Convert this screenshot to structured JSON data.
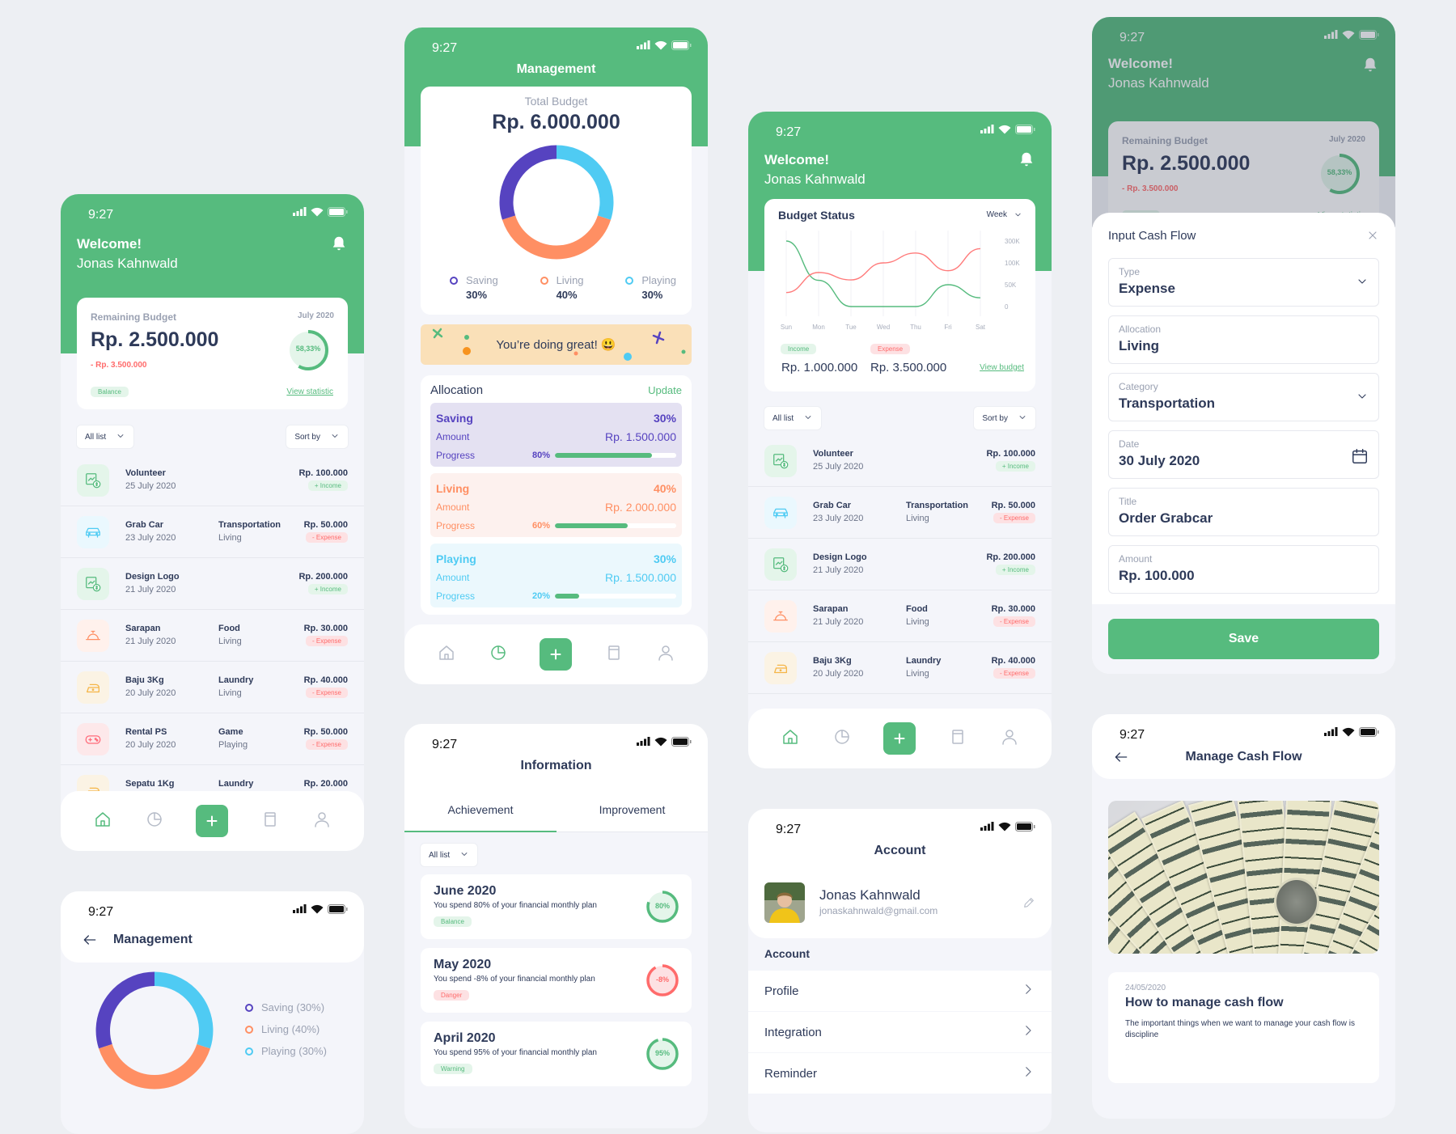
{
  "status_time": "9:27",
  "colors": {
    "green": "#56BB7E",
    "red": "#FF6B6B",
    "saving": "#5643C0",
    "living": "#FF8F63",
    "playing": "#4FCBF3",
    "text": "#2E3A59"
  },
  "nav_icons": [
    "home-icon",
    "pie-chart-icon",
    "plus-icon",
    "notebook-icon",
    "user-icon"
  ],
  "home": {
    "welcome": "Welcome!",
    "name": "Jonas Kahnwald",
    "card": {
      "label": "Remaining Budget",
      "month": "July 2020",
      "amount": "Rp. 2.500.000",
      "spent": "- Rp. 3.500.000",
      "badge": "Balance",
      "link": "View statistic",
      "percent_label": "58,33%",
      "percent": 58.33
    },
    "filters": {
      "all": "All list",
      "sort": "Sort by"
    },
    "transactions": [
      {
        "title": "Volunteer",
        "date": "25 July 2020",
        "category": "",
        "group": "",
        "amount": "Rp. 100.000",
        "type": "+ Income",
        "kind": "income",
        "icon": "income"
      },
      {
        "title": "Grab Car",
        "date": "23 July 2020",
        "category": "Transportation",
        "group": "Living",
        "amount": "Rp. 50.000",
        "type": "- Expense",
        "kind": "expense",
        "icon": "car"
      },
      {
        "title": "Design Logo",
        "date": "21 July 2020",
        "category": "",
        "group": "",
        "amount": "Rp. 200.000",
        "type": "+ Income",
        "kind": "income",
        "icon": "income"
      },
      {
        "title": "Sarapan",
        "date": "21 July 2020",
        "category": "Food",
        "group": "Living",
        "amount": "Rp. 30.000",
        "type": "- Expense",
        "kind": "expense",
        "icon": "food"
      },
      {
        "title": "Baju 3Kg",
        "date": "20 July 2020",
        "category": "Laundry",
        "group": "Living",
        "amount": "Rp. 40.000",
        "type": "- Expense",
        "kind": "expense",
        "icon": "laundry"
      },
      {
        "title": "Rental PS",
        "date": "20 July 2020",
        "category": "Game",
        "group": "Playing",
        "amount": "Rp. 50.000",
        "type": "- Expense",
        "kind": "expense",
        "icon": "game"
      },
      {
        "title": "Sepatu 1Kg",
        "date": "",
        "category": "Laundry",
        "group": "",
        "amount": "Rp. 20.000",
        "type": "",
        "kind": "expense",
        "icon": "laundry"
      }
    ]
  },
  "management": {
    "title": "Management",
    "total_label": "Total Budget",
    "total": "Rp. 6.000.000",
    "legend": [
      {
        "name": "Saving",
        "pct": "30%",
        "value": 30,
        "color": "#5643C0"
      },
      {
        "name": "Living",
        "pct": "40%",
        "value": 40,
        "color": "#FF8F63"
      },
      {
        "name": "Playing",
        "pct": "30%",
        "value": 30,
        "color": "#4FCBF3"
      }
    ],
    "banner": "You’re doing great! 😃",
    "allocation": {
      "title": "Allocation",
      "update": "Update",
      "items": [
        {
          "name": "Saving",
          "pct": "30%",
          "amount_label": "Amount",
          "amount": "Rp. 1.500.000",
          "progress_label": "Progress",
          "progress_text": "80%",
          "progress": 80,
          "color": "#5643C0",
          "bg": "#E4E1F2"
        },
        {
          "name": "Living",
          "pct": "40%",
          "amount_label": "Amount",
          "amount": "Rp. 2.000.000",
          "progress_label": "Progress",
          "progress_text": "60%",
          "progress": 60,
          "color": "#FF8F63",
          "bg": "#FDF1EE"
        },
        {
          "name": "Playing",
          "pct": "30%",
          "amount_label": "Amount",
          "amount": "Rp. 1.500.000",
          "progress_label": "Progress",
          "progress_text": "20%",
          "progress": 20,
          "color": "#4FCBF3",
          "bg": "#EBF8FD"
        }
      ]
    }
  },
  "dashboard": {
    "welcome": "Welcome!",
    "name": "Jonas Kahnwald",
    "budget_status": {
      "title": "Budget Status",
      "period": "Week",
      "income_label": "Income",
      "income": "Rp. 1.000.000",
      "expense_label": "Expense",
      "expense": "Rp. 3.500.000",
      "link": "View budget"
    }
  },
  "chart_data": {
    "type": "line",
    "title": "Budget Status",
    "categories": [
      "Sun",
      "Mon",
      "Tue",
      "Wed",
      "Thu",
      "Fri",
      "Sat"
    ],
    "y_ticks": [
      "300K",
      "100K",
      "50K",
      "0"
    ],
    "y_tick_values": [
      300000,
      100000,
      50000,
      0
    ],
    "grid": "vertical",
    "series": [
      {
        "name": "Income",
        "color": "#56BB7E",
        "values": [
          300000,
          60000,
          0,
          0,
          0,
          50000,
          20000
        ]
      },
      {
        "name": "Expense",
        "color": "#FF7B7B",
        "values": [
          32000,
          78000,
          61000,
          100000,
          190000,
          82000,
          230000
        ]
      }
    ]
  },
  "input_form": {
    "title": "Input Cash Flow",
    "fields": [
      {
        "label": "Type",
        "value": "Expense",
        "control": "chevron-down-icon"
      },
      {
        "label": "Allocation",
        "value": "Living",
        "control": ""
      },
      {
        "label": "Category",
        "value": "Transportation",
        "control": "chevron-down-icon"
      },
      {
        "label": "Date",
        "value": "30 July 2020",
        "control": "calendar-icon"
      },
      {
        "label": "Title",
        "value": "Order Grabcar",
        "control": ""
      },
      {
        "label": "Amount",
        "value": "Rp. 100.000",
        "control": ""
      }
    ],
    "save": "Save"
  },
  "management2": {
    "title": "Management",
    "legend": [
      "Saving (30%)",
      "Living (40%)",
      "Playing (30%)"
    ]
  },
  "information": {
    "title": "Information",
    "tabs": [
      "Achievement",
      "Improvement"
    ],
    "active_tab": 0,
    "filter": "All list",
    "items": [
      {
        "month": "June 2020",
        "text": "You spend 80% of your financial monthly plan",
        "badge": "Balance",
        "pct_label": "80%",
        "pct": 80,
        "status": "good"
      },
      {
        "month": "May 2020",
        "text": "You spend -8% of your financial monthly plan",
        "badge": "Danger",
        "pct_label": "-8%",
        "pct": -8,
        "status": "danger"
      },
      {
        "month": "April 2020",
        "text": "You spend 95% of your financial monthly plan",
        "badge": "Warning",
        "pct_label": "95%",
        "pct": 95,
        "status": "good"
      }
    ]
  },
  "account": {
    "title": "Account",
    "name": "Jonas Kahnwald",
    "email": "jonaskahnwald@gmail.com",
    "section": "Account",
    "items": [
      "Profile",
      "Integration",
      "Reminder"
    ]
  },
  "article": {
    "title": "Manage Cash Flow",
    "date": "24/05/2020",
    "heading": "How to manage cash flow",
    "body": "The important things when we want to manage your cash flow is discipline"
  }
}
